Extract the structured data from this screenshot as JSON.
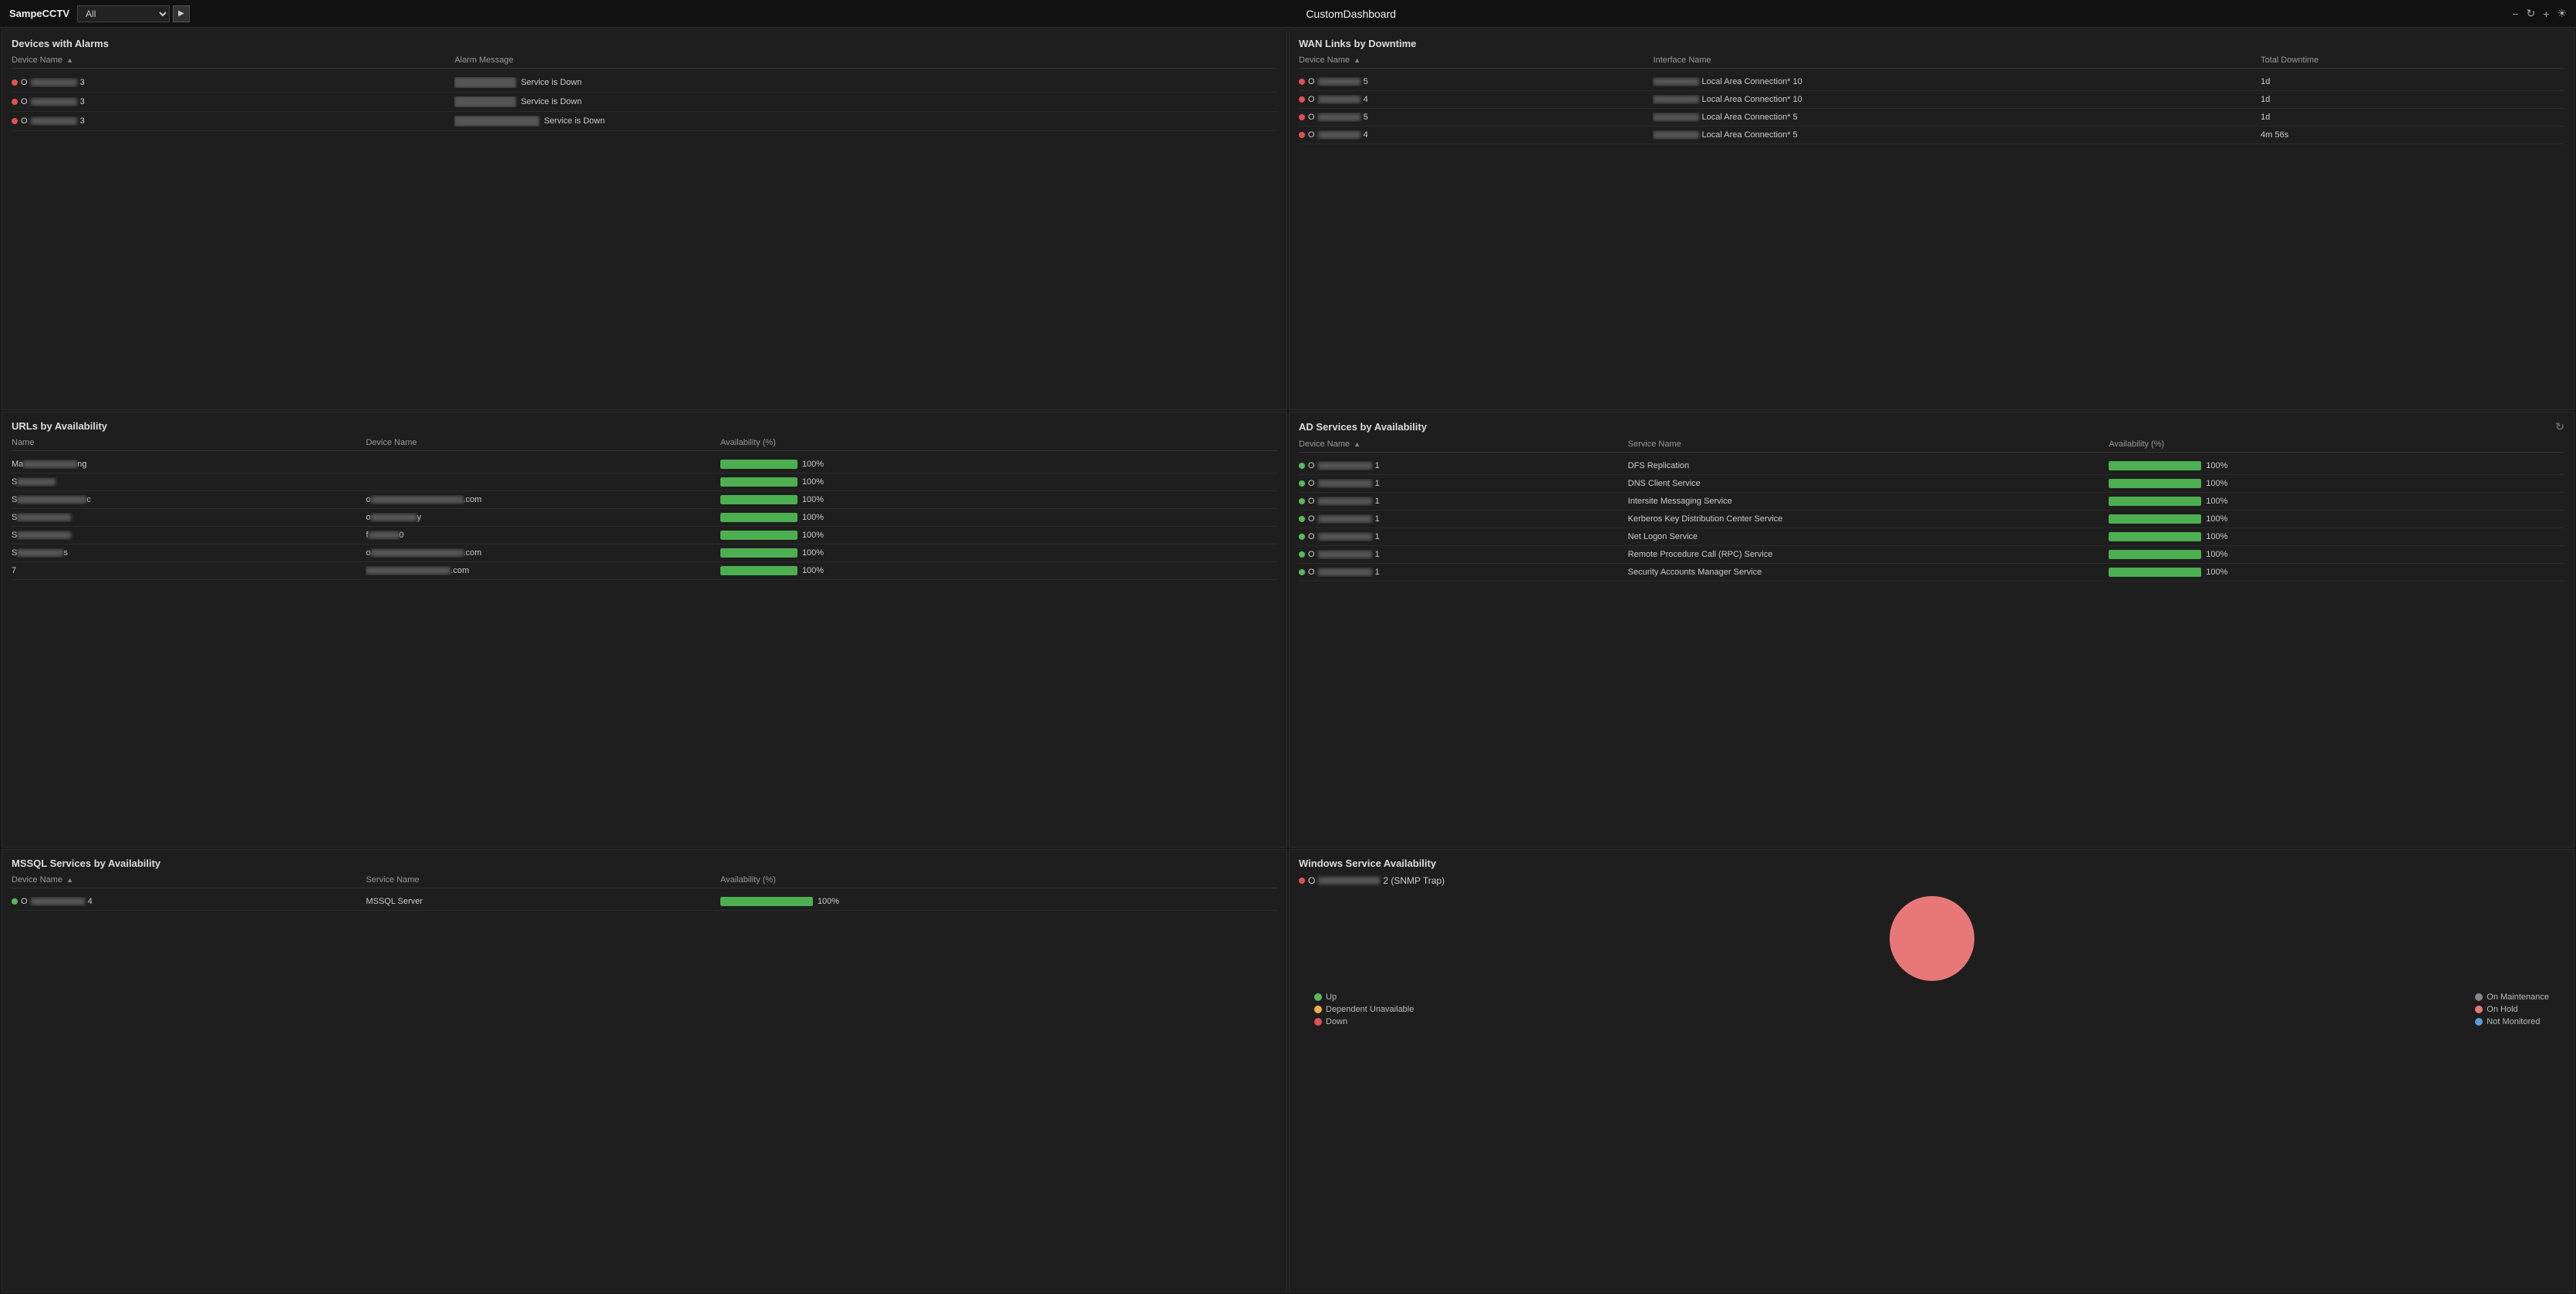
{
  "nav": {
    "brand": "SampeCCTV",
    "filter_value": "All",
    "title": "CustomDashboard",
    "icons": {
      "minus": "−",
      "refresh": "↻",
      "plus": "+",
      "sun": "☀"
    }
  },
  "devices_alarms": {
    "title": "Devices with Alarms",
    "headers": {
      "device_name": "Device Name",
      "alarm_message": "Alarm Message"
    },
    "rows": [
      {
        "id": "row1",
        "device_prefix": "O",
        "device_bar_width": 60,
        "device_suffix": "3",
        "alarm_bar_width": 80,
        "alarm_text": "Service is Down"
      },
      {
        "id": "row2",
        "device_prefix": "O",
        "device_bar_width": 60,
        "device_suffix": "3",
        "alarm_bar_width": 80,
        "alarm_text": "Service is Down"
      },
      {
        "id": "row3",
        "device_prefix": "O",
        "device_bar_width": 60,
        "device_suffix": "3",
        "alarm_bar_width": 110,
        "alarm_text": "Service is Down"
      }
    ]
  },
  "wan_links": {
    "title": "WAN Links by Downtime",
    "headers": {
      "device_name": "Device Name",
      "interface_name": "Interface Name",
      "total_downtime": "Total Downtime"
    },
    "rows": [
      {
        "id": "row1",
        "device_prefix": "O",
        "device_bar_width": 55,
        "device_suffix": "5",
        "iface_bar_width": 60,
        "iface_text": "Local Area Connection* 10",
        "downtime": "1d"
      },
      {
        "id": "row2",
        "device_prefix": "O",
        "device_bar_width": 55,
        "device_suffix": "4",
        "iface_bar_width": 60,
        "iface_text": "Local Area Connection* 10",
        "downtime": "1d"
      },
      {
        "id": "row3",
        "device_prefix": "O",
        "device_bar_width": 55,
        "device_suffix": "5",
        "iface_bar_width": 60,
        "iface_text": "Local Area Connection* 5",
        "downtime": "1d"
      },
      {
        "id": "row4",
        "device_prefix": "O",
        "device_bar_width": 55,
        "device_suffix": "4",
        "iface_bar_width": 60,
        "iface_text": "Local Area Connection* 5",
        "downtime": "4m 56s"
      }
    ]
  },
  "urls_availability": {
    "title": "URLs by Availability",
    "headers": {
      "name": "Name",
      "device_name": "Device Name",
      "availability": "Availability (%)"
    },
    "rows": [
      {
        "id": "row1",
        "name_prefix": "Ma",
        "name_bar_width": 70,
        "name_suffix": "ng",
        "device_bar_width": 0,
        "device_text": "",
        "pct": 100
      },
      {
        "id": "row2",
        "name_prefix": "S",
        "name_bar_width": 50,
        "name_suffix": "",
        "device_bar_width": 0,
        "device_text": "",
        "pct": 100
      },
      {
        "id": "row3",
        "name_prefix": "S",
        "name_bar_width": 90,
        "name_suffix": "c",
        "device_prefix": "o",
        "device_bar_width": 120,
        "device_text": ".com",
        "pct": 100
      },
      {
        "id": "row4",
        "name_prefix": "S",
        "name_bar_width": 70,
        "name_suffix": "",
        "device_prefix": "o",
        "device_bar_width": 60,
        "device_text": "y",
        "pct": 100
      },
      {
        "id": "row5",
        "name_prefix": "S",
        "name_bar_width": 70,
        "name_suffix": "",
        "device_prefix": "f",
        "device_bar_width": 40,
        "device_text": "0",
        "pct": 100
      },
      {
        "id": "row6",
        "name_prefix": "S",
        "name_bar_width": 60,
        "name_suffix": "s",
        "device_prefix": "o",
        "device_bar_width": 120,
        "device_text": ".com",
        "pct": 100
      },
      {
        "id": "row7",
        "name_prefix": "7",
        "name_bar_width": 0,
        "name_suffix": "",
        "device_prefix": "",
        "device_bar_width": 110,
        "device_text": ".com",
        "pct": 100
      }
    ]
  },
  "ad_services": {
    "title": "AD Services by Availability",
    "headers": {
      "device_name": "Device Name",
      "service_name": "Service Name",
      "availability": "Availability (%)"
    },
    "rows": [
      {
        "id": "row1",
        "device_prefix": "O",
        "device_bar_width": 70,
        "device_suffix": "1",
        "service": "DFS Replication",
        "pct": 100
      },
      {
        "id": "row2",
        "device_prefix": "O",
        "device_bar_width": 70,
        "device_suffix": "1",
        "service": "DNS Client Service",
        "pct": 100
      },
      {
        "id": "row3",
        "device_prefix": "O",
        "device_bar_width": 70,
        "device_suffix": "1",
        "service": "Intersite Messaging Service",
        "pct": 100
      },
      {
        "id": "row4",
        "device_prefix": "O",
        "device_bar_width": 70,
        "device_suffix": "1",
        "service": "Kerberos Key Distribution Center Service",
        "pct": 100
      },
      {
        "id": "row5",
        "device_prefix": "O",
        "device_bar_width": 70,
        "device_suffix": "1",
        "service": "Net Logon Service",
        "pct": 100
      },
      {
        "id": "row6",
        "device_prefix": "O",
        "device_bar_width": 70,
        "device_suffix": "1",
        "service": "Remote Procedure Call (RPC) Service",
        "pct": 100
      },
      {
        "id": "row7",
        "device_prefix": "O",
        "device_bar_width": 70,
        "device_suffix": "1",
        "service": "Security Accounts Manager Service",
        "pct": 100
      }
    ]
  },
  "mssql_services": {
    "title": "MSSQL Services by Availability",
    "headers": {
      "device_name": "Device Name",
      "service_name": "Service Name",
      "availability": "Availability (%)"
    },
    "rows": [
      {
        "id": "row1",
        "device_prefix": "O",
        "device_bar_width": 70,
        "device_suffix": "4",
        "service": "MSSQL Server",
        "pct": 100
      }
    ]
  },
  "windows_service": {
    "title": "Windows Service Availability",
    "device_prefix": "O",
    "device_bar_width": 80,
    "device_suffix": "2 (SNMP Trap)",
    "chart": {
      "circle_color": "#e87878",
      "circle_size": 110
    },
    "legend": {
      "left": [
        {
          "label": "Up",
          "color": "#5cb85c"
        },
        {
          "label": "Dependent Unavailable",
          "color": "#f0ad4e"
        },
        {
          "label": "Down",
          "color": "#e05252"
        }
      ],
      "right": [
        {
          "label": "On Maintenance",
          "color": "#888"
        },
        {
          "label": "On Hold",
          "color": "#e87878"
        },
        {
          "label": "Not Monitored",
          "color": "#5b9bd5"
        }
      ]
    }
  }
}
